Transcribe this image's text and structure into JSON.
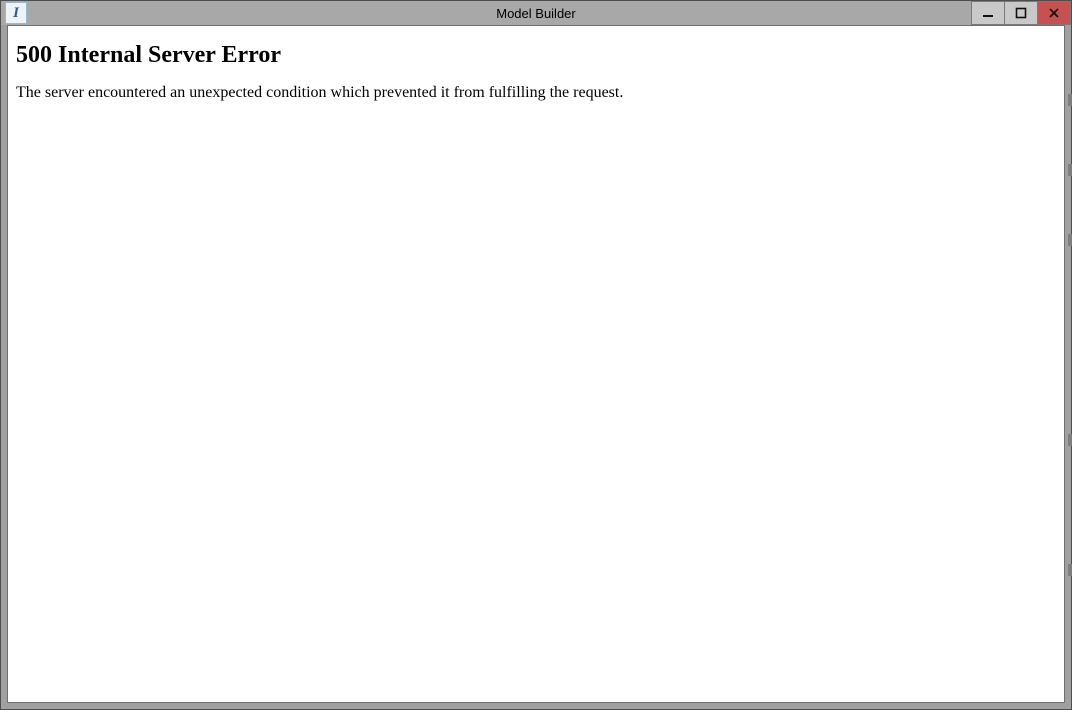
{
  "window": {
    "title": "Model Builder",
    "icon_letter": "I",
    "icons": {
      "app": "app-icon",
      "minimize": "minimize-icon",
      "maximize": "maximize-icon",
      "close": "close-icon"
    }
  },
  "page": {
    "error": {
      "title": "500 Internal Server Error",
      "message": "The server encountered an unexpected condition which prevented it from fulfilling the request."
    }
  }
}
